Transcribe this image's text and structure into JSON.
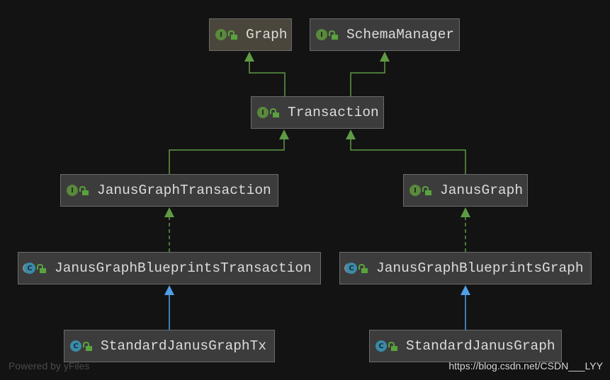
{
  "nodes": [
    {
      "id": "graph",
      "label": "Graph",
      "kind": "interface"
    },
    {
      "id": "schema",
      "label": "SchemaManager",
      "kind": "interface"
    },
    {
      "id": "tx",
      "label": "Transaction",
      "kind": "interface"
    },
    {
      "id": "jgt",
      "label": "JanusGraphTransaction",
      "kind": "interface"
    },
    {
      "id": "jg",
      "label": "JanusGraph",
      "kind": "interface"
    },
    {
      "id": "jgbt",
      "label": "JanusGraphBlueprintsTransaction",
      "kind": "abstract-class"
    },
    {
      "id": "jgbg",
      "label": "JanusGraphBlueprintsGraph",
      "kind": "abstract-class"
    },
    {
      "id": "sjgtx",
      "label": "StandardJanusGraphTx",
      "kind": "class"
    },
    {
      "id": "sjg",
      "label": "StandardJanusGraph",
      "kind": "class"
    }
  ],
  "edges": [
    {
      "from": "tx",
      "to": "graph",
      "type": "extends"
    },
    {
      "from": "tx",
      "to": "schema",
      "type": "extends"
    },
    {
      "from": "jgt",
      "to": "tx",
      "type": "extends"
    },
    {
      "from": "jg",
      "to": "tx",
      "type": "extends"
    },
    {
      "from": "jgbt",
      "to": "jgt",
      "type": "implements"
    },
    {
      "from": "jgbg",
      "to": "jg",
      "type": "implements"
    },
    {
      "from": "sjgtx",
      "to": "jgbt",
      "type": "extends-class"
    },
    {
      "from": "sjg",
      "to": "jgbg",
      "type": "extends-class"
    }
  ],
  "icons": {
    "interface": "I",
    "class": "C"
  },
  "colors": {
    "background": "#131313",
    "interface_edge": "#5f9a45",
    "class_edge": "#4f9ee8",
    "node_bg": "#3c3c3c",
    "selected_node_bg": "#4a463b"
  },
  "footer": {
    "powered": "Powered by yFiles",
    "watermark": "https://blog.csdn.net/CSDN___LYY"
  }
}
